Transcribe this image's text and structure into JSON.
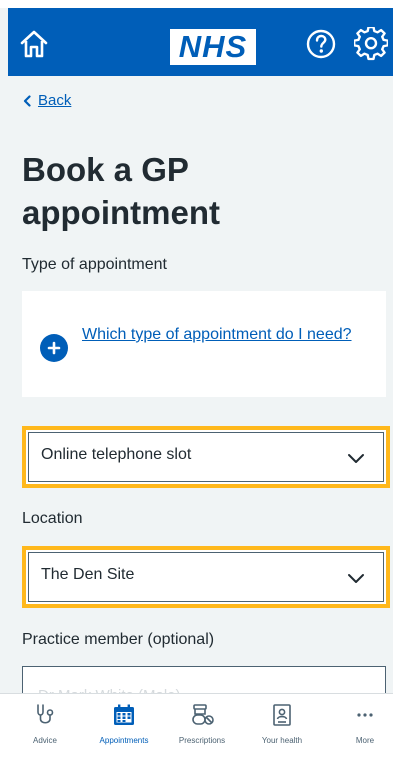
{
  "header": {
    "logo_text": "NHS",
    "home_icon": "home-icon",
    "help_icon": "help-icon",
    "settings_icon": "gear-icon",
    "brand_color": "#005eb8"
  },
  "nav": {
    "back_label": "Back"
  },
  "page": {
    "title": "Book a GP appointment",
    "type_label": "Type of appointment",
    "help_link": "Which type of appointment do I need?",
    "type_value": "Online telephone slot",
    "location_label": "Location",
    "location_value": "The Den Site",
    "practice_label": "Practice member (optional)",
    "practice_placeholder": "Dr Mark White (Male)"
  },
  "highlight_color": "#ffb81c",
  "tabbar": {
    "items": [
      {
        "label": "Advice",
        "icon": "stethoscope-icon"
      },
      {
        "label": "Appointments",
        "icon": "calendar-icon",
        "active": true
      },
      {
        "label": "Prescriptions",
        "icon": "pills-icon"
      },
      {
        "label": "Your health",
        "icon": "health-record-icon"
      },
      {
        "label": "More",
        "icon": "more-dots-icon"
      }
    ]
  }
}
